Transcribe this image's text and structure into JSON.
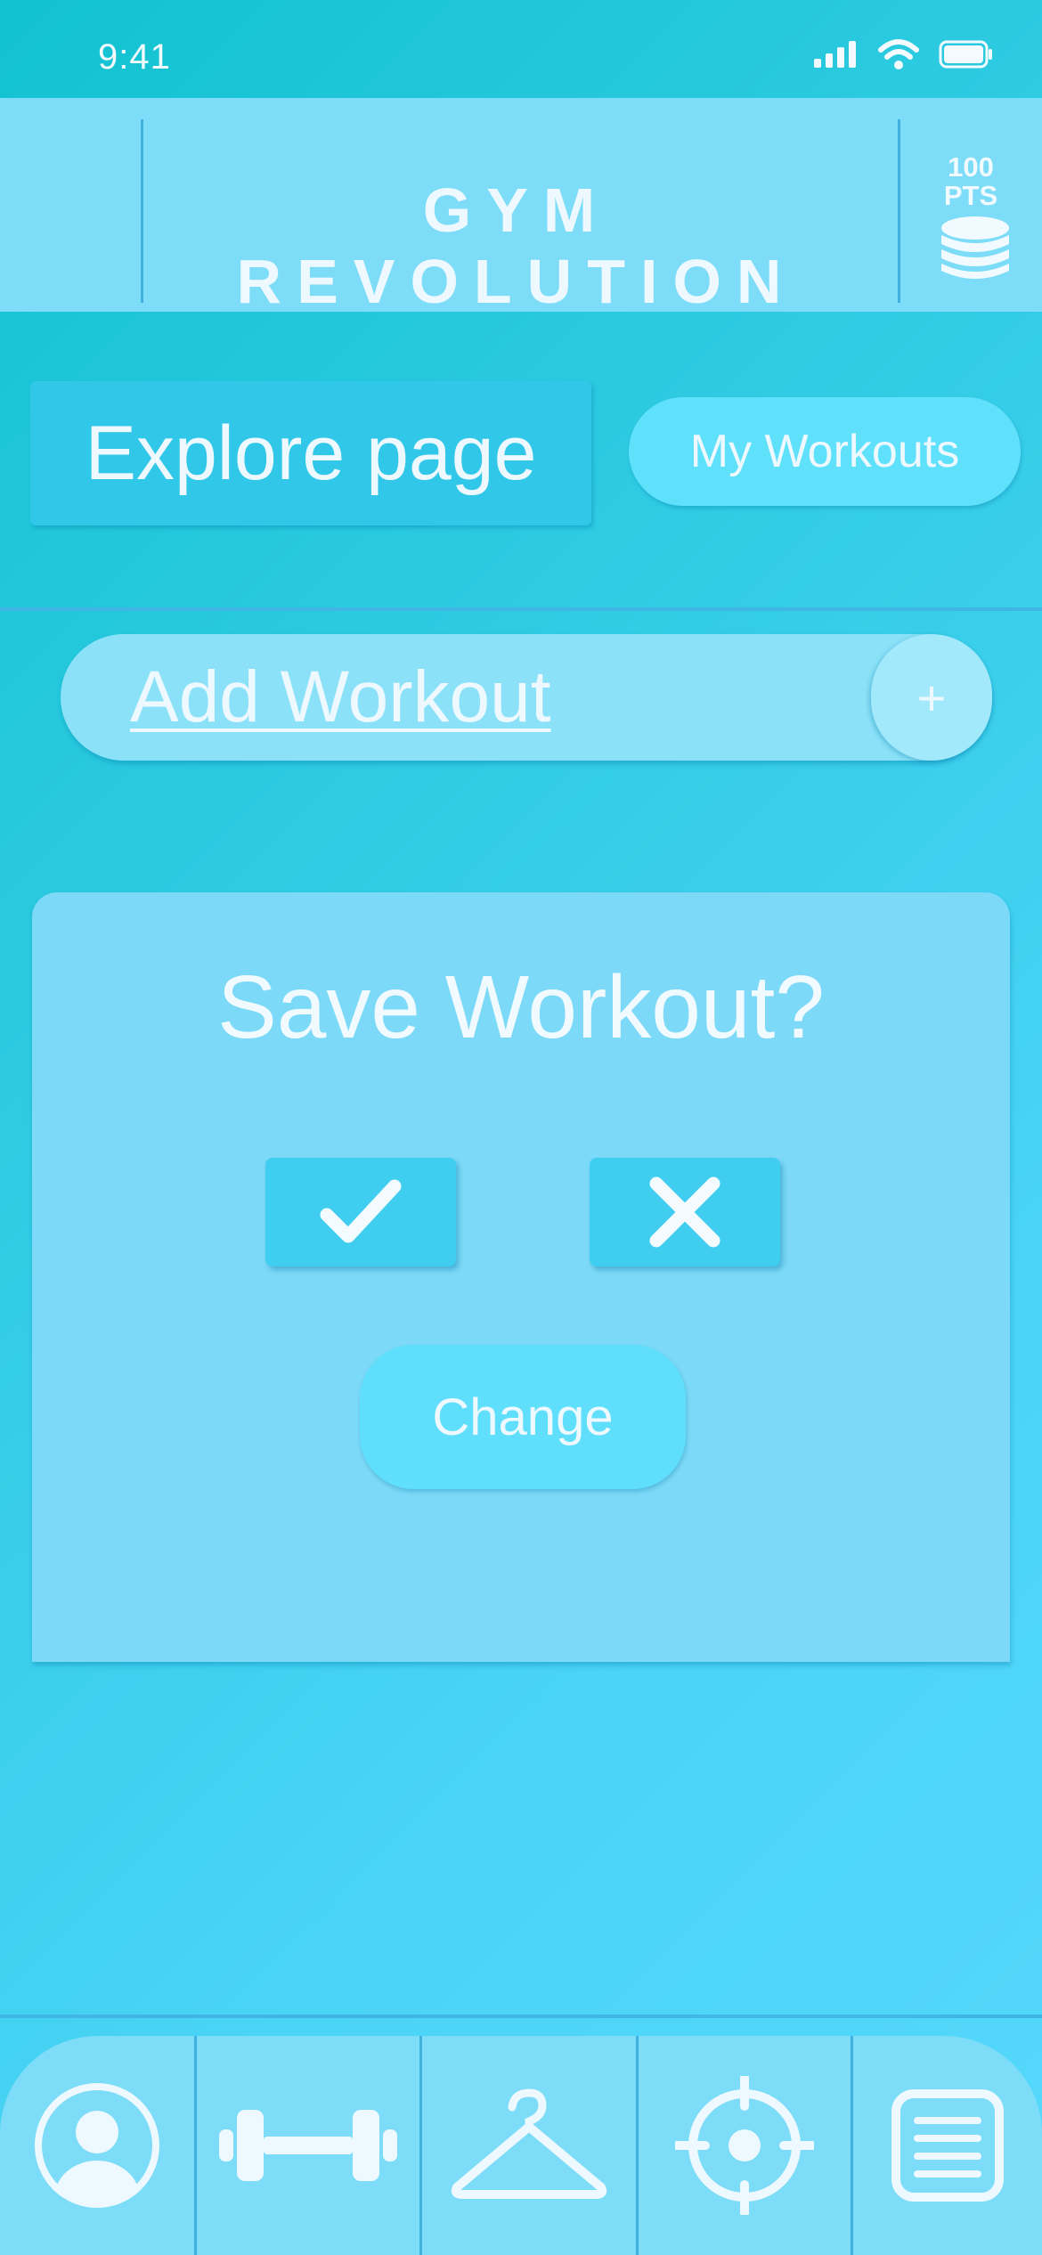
{
  "status_bar": {
    "time": "9:41",
    "icons": [
      "signal-icon",
      "wifi-icon",
      "battery-icon"
    ]
  },
  "header": {
    "title": "GYM REVOLUTION",
    "points_value": "100",
    "points_unit": "PTS",
    "points_icon": "coin-stack-icon"
  },
  "tabs": {
    "explore": "Explore page",
    "my_workouts": "My Workouts"
  },
  "add_workout": {
    "label": "Add Workout",
    "plus": "+"
  },
  "dialog": {
    "title": "Save Workout?",
    "confirm_icon": "check-icon",
    "cancel_icon": "x-icon",
    "change_label": "Change"
  },
  "bottom_nav": {
    "items": [
      "profile-icon",
      "dumbbell-icon",
      "hanger-icon",
      "target-icon",
      "list-icon"
    ]
  },
  "colors": {
    "background": "#4ad4f6",
    "header": "#7ddcf7",
    "accent": "#30c7e8",
    "text": "#eef9ff"
  }
}
